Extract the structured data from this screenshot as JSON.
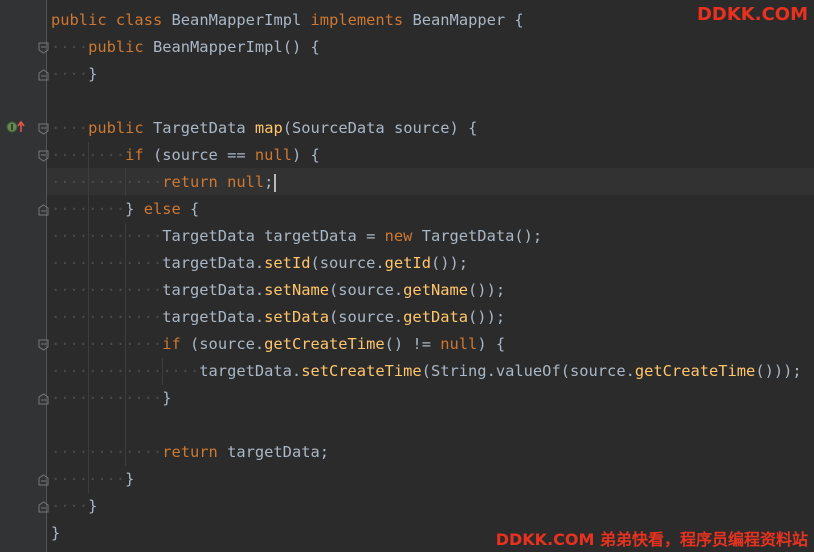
{
  "editor": {
    "lines": [
      {
        "indent": "",
        "tokens": [
          [
            "kw",
            "public"
          ],
          [
            "plain",
            " "
          ],
          [
            "kw",
            "class"
          ],
          [
            "plain",
            " "
          ],
          [
            "cls",
            "BeanMapperImpl"
          ],
          [
            "plain",
            " "
          ],
          [
            "kw",
            "implements"
          ],
          [
            "plain",
            " "
          ],
          [
            "cls",
            "BeanMapper"
          ],
          [
            "plain",
            " {"
          ]
        ]
      },
      {
        "indent": "····",
        "tokens": [
          [
            "kw",
            "public"
          ],
          [
            "plain",
            " "
          ],
          [
            "cls",
            "BeanMapperImpl"
          ],
          [
            "plain",
            "() {"
          ]
        ]
      },
      {
        "indent": "····",
        "tokens": [
          [
            "plain",
            "}"
          ]
        ]
      },
      {
        "indent": "",
        "tokens": []
      },
      {
        "indent": "····",
        "tokens": [
          [
            "kw",
            "public"
          ],
          [
            "plain",
            " "
          ],
          [
            "cls",
            "TargetData"
          ],
          [
            "plain",
            " "
          ],
          [
            "fn",
            "map"
          ],
          [
            "plain",
            "("
          ],
          [
            "cls",
            "SourceData"
          ],
          [
            "plain",
            " source) {"
          ]
        ]
      },
      {
        "indent": "········",
        "tokens": [
          [
            "kw",
            "if"
          ],
          [
            "plain",
            " (source == "
          ],
          [
            "kw",
            "null"
          ],
          [
            "plain",
            ") {"
          ]
        ]
      },
      {
        "indent": "············",
        "tokens": [
          [
            "kw",
            "return"
          ],
          [
            "plain",
            " "
          ],
          [
            "kw",
            "null"
          ],
          [
            "plain",
            ";"
          ]
        ]
      },
      {
        "indent": "········",
        "tokens": [
          [
            "plain",
            "} "
          ],
          [
            "kw",
            "else"
          ],
          [
            "plain",
            " {"
          ]
        ]
      },
      {
        "indent": "············",
        "tokens": [
          [
            "cls",
            "TargetData"
          ],
          [
            "plain",
            " targetData = "
          ],
          [
            "kw",
            "new"
          ],
          [
            "plain",
            " "
          ],
          [
            "cls",
            "TargetData"
          ],
          [
            "plain",
            "();"
          ]
        ]
      },
      {
        "indent": "············",
        "tokens": [
          [
            "plain",
            "targetData."
          ],
          [
            "fn",
            "setId"
          ],
          [
            "plain",
            "(source."
          ],
          [
            "fn",
            "getId"
          ],
          [
            "plain",
            "());"
          ]
        ]
      },
      {
        "indent": "············",
        "tokens": [
          [
            "plain",
            "targetData."
          ],
          [
            "fn",
            "setName"
          ],
          [
            "plain",
            "(source."
          ],
          [
            "fn",
            "getName"
          ],
          [
            "plain",
            "());"
          ]
        ]
      },
      {
        "indent": "············",
        "tokens": [
          [
            "plain",
            "targetData."
          ],
          [
            "fn",
            "setData"
          ],
          [
            "plain",
            "(source."
          ],
          [
            "fn",
            "getData"
          ],
          [
            "plain",
            "());"
          ]
        ]
      },
      {
        "indent": "············",
        "tokens": [
          [
            "kw",
            "if"
          ],
          [
            "plain",
            " (source."
          ],
          [
            "fn",
            "getCreateTime"
          ],
          [
            "plain",
            "() != "
          ],
          [
            "kw",
            "null"
          ],
          [
            "plain",
            ") {"
          ]
        ]
      },
      {
        "indent": "················",
        "tokens": [
          [
            "plain",
            "targetData."
          ],
          [
            "fn",
            "setCreateTime"
          ],
          [
            "plain",
            "("
          ],
          [
            "cls",
            "String"
          ],
          [
            "plain",
            "."
          ],
          [
            "plain",
            "valueOf"
          ],
          [
            "plain",
            "(source."
          ],
          [
            "fn",
            "getCreateTime"
          ],
          [
            "plain",
            "()));"
          ]
        ]
      },
      {
        "indent": "············",
        "tokens": [
          [
            "plain",
            "}"
          ]
        ]
      },
      {
        "indent": "",
        "tokens": []
      },
      {
        "indent": "············",
        "tokens": [
          [
            "kw",
            "return"
          ],
          [
            "plain",
            " targetData;"
          ]
        ]
      },
      {
        "indent": "········",
        "tokens": [
          [
            "plain",
            "}"
          ]
        ]
      },
      {
        "indent": "····",
        "tokens": [
          [
            "plain",
            "}"
          ]
        ]
      },
      {
        "indent": "",
        "tokens": [
          [
            "plain",
            "}"
          ]
        ]
      }
    ],
    "caret_line": 6
  },
  "watermark": {
    "top": "DDKK.COM",
    "bottom": "DDKK.COM 弟弟快看，程序员编程资料站"
  },
  "colors": {
    "background": "#2b2b2b",
    "gutter": "#313335",
    "keyword": "#cc7832",
    "method": "#ffc66d",
    "text": "#a9b7c6",
    "watermark": "#e8321f"
  },
  "icons": {
    "implements_marker": "implementation-arrow-icon",
    "fold": "fold-toggle-icon"
  }
}
